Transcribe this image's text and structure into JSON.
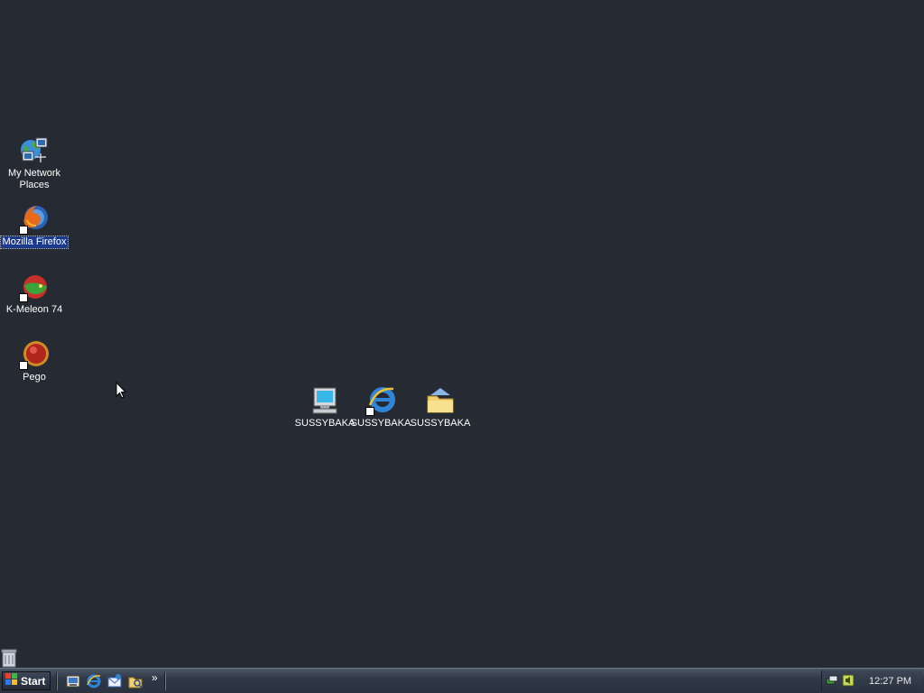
{
  "desktop": {
    "icons": [
      {
        "label": "My Network Places",
        "label_line1": "My Network",
        "label_line2": "Places",
        "icon": "network-places-icon"
      },
      {
        "label": "Mozilla Firefox",
        "icon": "firefox-icon",
        "shortcut": true,
        "selected": true
      },
      {
        "label": "K-Meleon 74",
        "icon": "kmeleon-icon",
        "shortcut": true
      },
      {
        "label": "Pego",
        "icon": "pego-icon",
        "shortcut": true
      },
      {
        "label": "SUSSYBAKA",
        "icon": "computer-icon"
      },
      {
        "label": "SUSSYBAKA",
        "icon": "internet-explorer-icon",
        "shortcut": true
      },
      {
        "label": "SUSSYBAKA",
        "icon": "folder-icon"
      }
    ]
  },
  "taskbar": {
    "start_label": "Start",
    "quick_launch": [
      {
        "icon": "show-desktop-icon"
      },
      {
        "icon": "internet-explorer-icon"
      },
      {
        "icon": "outlook-express-icon"
      },
      {
        "icon": "windows-explorer-icon"
      }
    ],
    "more_label": "»",
    "clock": "12:27 PM"
  },
  "colors": {
    "desktop_background": "#252a33",
    "selection": "#1c3a8c"
  }
}
